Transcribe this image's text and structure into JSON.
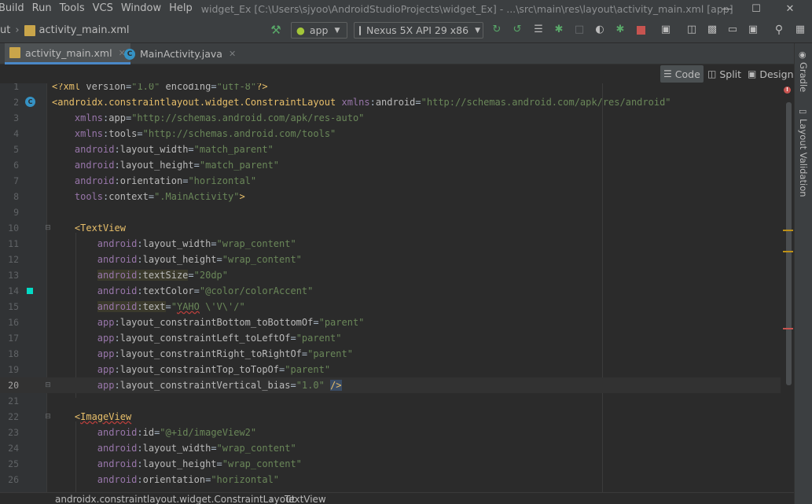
{
  "menu": {
    "items": [
      "Build",
      "Run",
      "Tools",
      "VCS",
      "Window",
      "Help"
    ],
    "title": "widget_Ex [C:\\Users\\sjyoo\\AndroidStudioProjects\\widget_Ex] - ...\\src\\main\\res\\layout\\activity_main.xml [app]"
  },
  "toolbar": {
    "crumb_prefix": "ut",
    "crumb_file": "activity_main.xml",
    "run_config": "app",
    "device": "Nexus 5X API 29 x86"
  },
  "tabs": [
    {
      "label": "activity_main.xml",
      "active": true
    },
    {
      "label": "MainActivity.java",
      "active": false
    }
  ],
  "editor_modes": {
    "code": "Code",
    "split": "Split",
    "design": "Design"
  },
  "right_tools": {
    "gradle": "Gradle",
    "layout_validation": "Layout Validation"
  },
  "current_line": 20,
  "code_lines": [
    {
      "n": "1",
      "text": "<?xml version=\"1.0\" encoding=\"utf-8\"?>"
    },
    {
      "n": "2",
      "text": "<androidx.constraintlayout.widget.ConstraintLayout xmlns:android=\"http://schemas.android.com/apk/res/android\""
    },
    {
      "n": "3",
      "text": "    xmlns:app=\"http://schemas.android.com/apk/res-auto\""
    },
    {
      "n": "4",
      "text": "    xmlns:tools=\"http://schemas.android.com/tools\""
    },
    {
      "n": "5",
      "text": "    android:layout_width=\"match_parent\""
    },
    {
      "n": "6",
      "text": "    android:layout_height=\"match_parent\""
    },
    {
      "n": "7",
      "text": "    android:orientation=\"horizontal\""
    },
    {
      "n": "8",
      "text": "    tools:context=\".MainActivity\">"
    },
    {
      "n": "9",
      "text": ""
    },
    {
      "n": "10",
      "text": "    <TextView"
    },
    {
      "n": "11",
      "text": "        android:layout_width=\"wrap_content\""
    },
    {
      "n": "12",
      "text": "        android:layout_height=\"wrap_content\""
    },
    {
      "n": "13",
      "text": "        android:textSize=\"20dp\""
    },
    {
      "n": "14",
      "text": "        android:textColor=\"@color/colorAccent\""
    },
    {
      "n": "15",
      "text": "        android:text=\"YAHO \\'V\\'/\""
    },
    {
      "n": "16",
      "text": "        app:layout_constraintBottom_toBottomOf=\"parent\""
    },
    {
      "n": "17",
      "text": "        app:layout_constraintLeft_toLeftOf=\"parent\""
    },
    {
      "n": "18",
      "text": "        app:layout_constraintRight_toRightOf=\"parent\""
    },
    {
      "n": "19",
      "text": "        app:layout_constraintTop_toTopOf=\"parent\""
    },
    {
      "n": "20",
      "text": "        app:layout_constraintVertical_bias=\"1.0\" />"
    },
    {
      "n": "21",
      "text": ""
    },
    {
      "n": "22",
      "text": "    <ImageView"
    },
    {
      "n": "23",
      "text": "        android:id=\"@+id/imageView2\""
    },
    {
      "n": "24",
      "text": "        android:layout_width=\"wrap_content\""
    },
    {
      "n": "25",
      "text": "        android:layout_height=\"wrap_content\""
    },
    {
      "n": "26",
      "text": "        android:orientation=\"horizontal\""
    }
  ],
  "breadcrumbs": [
    "androidx.constraintlayout.widget.ConstraintLayout",
    "TextView"
  ],
  "colors": {
    "accent": "#4a88c7",
    "tag": "#e8bf6a",
    "namespace": "#9876aa",
    "string": "#6a8759",
    "error": "#c75450",
    "warning": "#be9117",
    "color_swatch": "#03dac5"
  }
}
